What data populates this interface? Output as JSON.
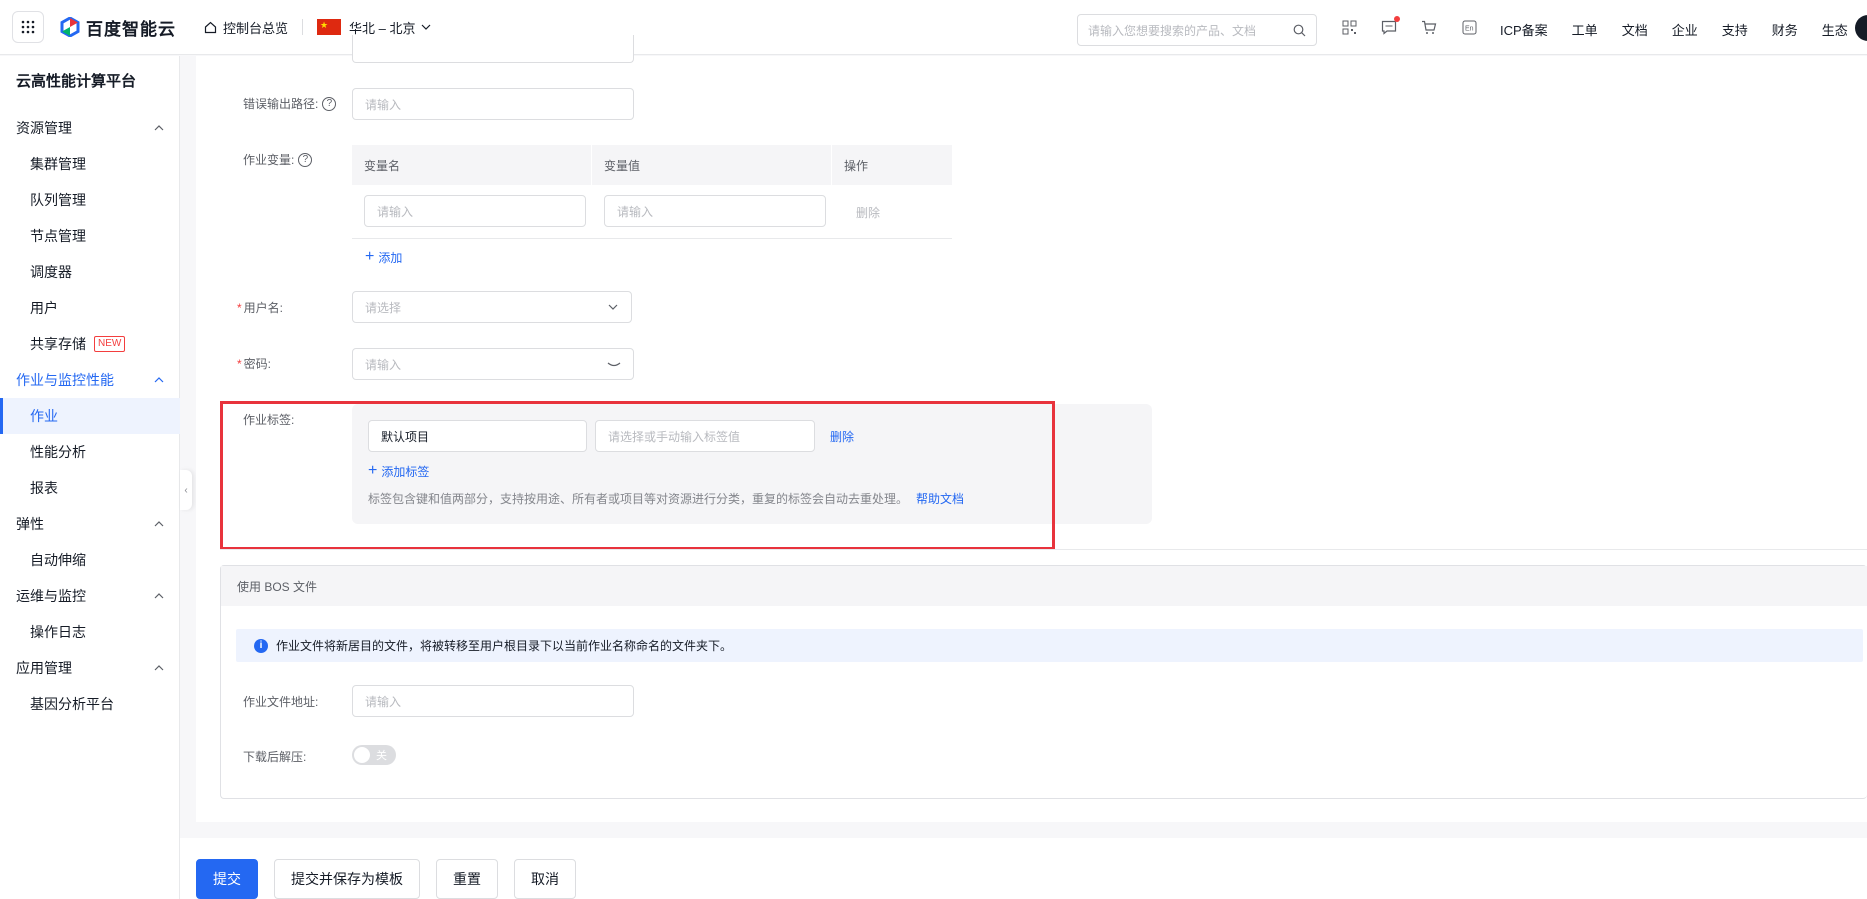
{
  "topbar": {
    "brand": "百度智能云",
    "home_label": "控制台总览",
    "region": "华北 – 北京",
    "search_placeholder": "请输入您想要搜索的产品、文档",
    "links": [
      "ICP备案",
      "工单",
      "文档",
      "企业",
      "支持",
      "财务",
      "生态"
    ]
  },
  "sidebar": {
    "title": "云高性能计算平台",
    "groups": {
      "resource": "资源管理",
      "job_monitor": "作业与监控性能",
      "elastic": "弹性",
      "ops": "运维与监控",
      "app": "应用管理"
    },
    "items": {
      "cluster": "集群管理",
      "queue": "队列管理",
      "node": "节点管理",
      "scheduler": "调度器",
      "user": "用户",
      "storage": "共享存储",
      "storage_badge": "NEW",
      "job": "作业",
      "perf": "性能分析",
      "report": "报表",
      "autoscale": "自动伸缩",
      "oplog": "操作日志",
      "gene": "基因分析平台"
    }
  },
  "form": {
    "err_path_label": "错误输出路径:",
    "err_path_placeholder": "请输入",
    "vars_label": "作业变量:",
    "vars_headers": [
      "变量名",
      "变量值",
      "操作"
    ],
    "var_name_placeholder": "请输入",
    "var_value_placeholder": "请输入",
    "var_delete": "删除",
    "var_add": "添加",
    "username_label": "用户名:",
    "username_placeholder": "请选择",
    "password_label": "密码:",
    "password_placeholder": "请输入",
    "tags_label": "作业标签:",
    "tag_key_value": "默认项目",
    "tag_value_placeholder": "请选择或手动输入标签值",
    "tag_delete": "删除",
    "tag_add": "添加标签",
    "tag_note": "标签包含键和值两部分，支持按用途、所有者或项目等对资源进行分类，重复的标签会自动去重处理。",
    "tag_help_link": "帮助文档"
  },
  "bos": {
    "title": "使用 BOS 文件",
    "info": "作业文件将新居目的文件，将被转移至用户根目录下以当前作业名称命名的文件夹下。",
    "file_label": "作业文件地址:",
    "file_placeholder": "请输入",
    "unzip_label": "下载后解压:",
    "unzip_toggle": "关"
  },
  "footer": {
    "submit": "提交",
    "submit_save": "提交并保存为模板",
    "reset": "重置",
    "cancel": "取消"
  },
  "colors": {
    "accent": "#2468f2",
    "highlight": "#e8333c"
  }
}
